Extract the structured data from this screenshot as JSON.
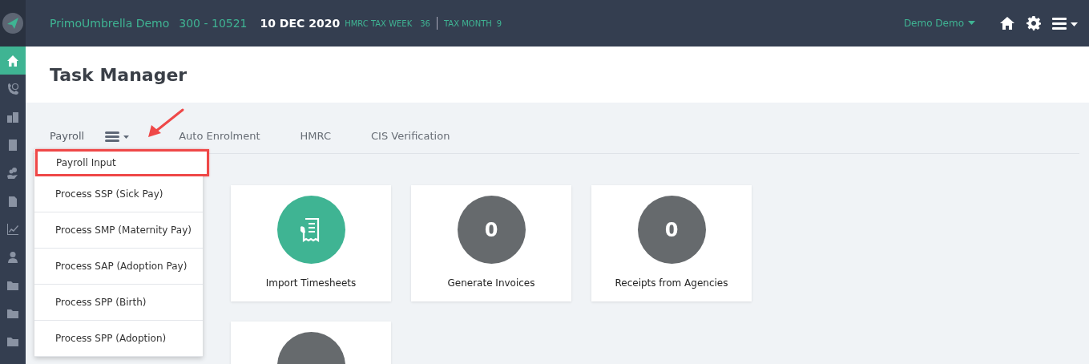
{
  "topbar": {
    "company": "PrimoUmbrella Demo",
    "code": "300 - 10521",
    "date": "10 DEC 2020",
    "tax_week_label": "HMRC TAX WEEK",
    "tax_week": "36",
    "tax_month_label": "TAX MONTH",
    "tax_month": "9",
    "user": "Demo Demo"
  },
  "sidebar": {
    "items": [
      {
        "kind": "home",
        "selected": true
      },
      {
        "kind": "phone",
        "selected": false
      },
      {
        "kind": "buildings",
        "selected": false
      },
      {
        "kind": "building",
        "selected": false
      },
      {
        "kind": "coins",
        "selected": false
      },
      {
        "kind": "download",
        "selected": false
      },
      {
        "kind": "chart",
        "selected": false
      },
      {
        "kind": "person",
        "selected": false
      },
      {
        "kind": "folder",
        "selected": false
      },
      {
        "kind": "folder",
        "selected": false
      },
      {
        "kind": "folder",
        "selected": false
      }
    ]
  },
  "page": {
    "title": "Task Manager"
  },
  "tabs": [
    {
      "label": "Payroll",
      "selected": true,
      "menu": true
    },
    {
      "label": "Auto Enrolment",
      "selected": false,
      "menu": false
    },
    {
      "label": "HMRC",
      "selected": false,
      "menu": false
    },
    {
      "label": "CIS Verification",
      "selected": false,
      "menu": false
    }
  ],
  "dropdown": {
    "items": [
      {
        "label": "Payroll Input",
        "highlighted": true
      },
      {
        "label": "Process SSP (Sick Pay)",
        "highlighted": false
      },
      {
        "label": "Process SMP (Maternity Pay)",
        "highlighted": false
      },
      {
        "label": "Process SAP (Adoption Pay)",
        "highlighted": false
      },
      {
        "label": "Process SPP (Birth)",
        "highlighted": false
      },
      {
        "label": "Process SPP (Adoption)",
        "highlighted": false
      }
    ]
  },
  "cards": [
    {
      "kind": "icon",
      "label": "Import Timesheets"
    },
    {
      "kind": "count",
      "count": "0",
      "label": "Generate Invoices"
    },
    {
      "kind": "count",
      "count": "0",
      "label": "Receipts from Agencies"
    },
    {
      "kind": "count"
    }
  ]
}
